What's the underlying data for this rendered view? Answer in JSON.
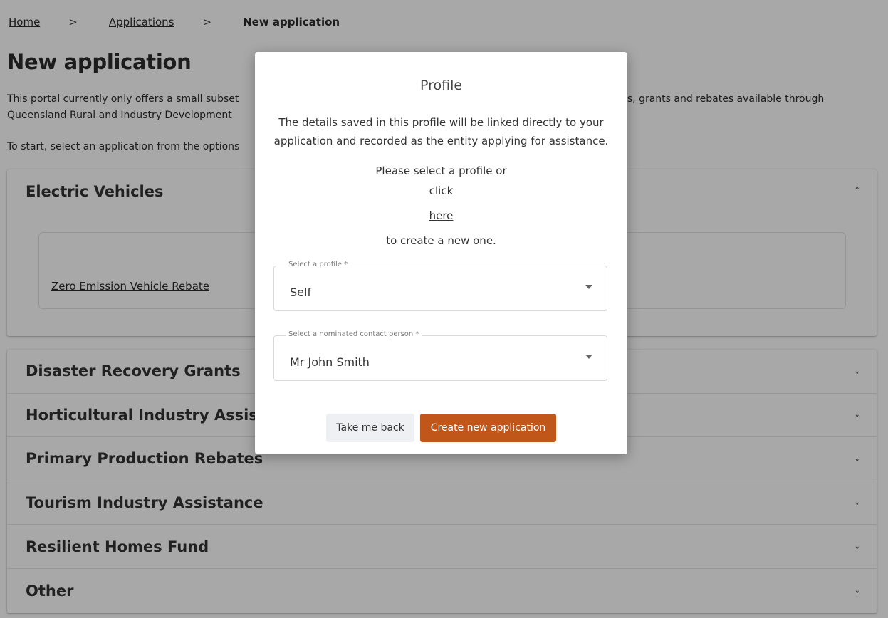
{
  "breadcrumb": {
    "items": [
      {
        "label": "Home"
      },
      {
        "label": "Applications"
      },
      {
        "label": "New application"
      }
    ],
    "separator": ">"
  },
  "page": {
    "title": "New application",
    "intro": "This portal currently only offers a small subset of the loans, grants and rebates available through Queensland Rural and Industry Development Authority. For the full range of loans, grants and rebates available through Queensland Rural and Industry Development Authority, visit our website.",
    "intro_visible_left": "This portal currently only offers a small subset",
    "intro_visible_right": "ns, grants and rebates available through",
    "intro_line2_left": "Queensland Rural and Industry Development",
    "instructions": "To start, select an application from the options"
  },
  "accordion": {
    "sections": [
      {
        "title": "Electric Vehicles",
        "expanded": true,
        "items": [
          {
            "label": "Zero Emission Vehicle Rebate"
          }
        ]
      },
      {
        "title": "Disaster Recovery Grants",
        "expanded": false
      },
      {
        "title": "Horticultural Industry Assistance",
        "expanded": false
      },
      {
        "title": "Primary Production Rebates",
        "expanded": false
      },
      {
        "title": "Tourism Industry Assistance",
        "expanded": false
      },
      {
        "title": "Resilient Homes Fund",
        "expanded": false
      },
      {
        "title": "Other",
        "expanded": false
      }
    ]
  },
  "modal": {
    "title": "Profile",
    "description": "The details saved in this profile will be linked directly to your application and recorded as the entity applying for assistance.",
    "select_prompt": "Please select a profile or",
    "click_text": "click",
    "here_link": "here",
    "create_suffix": "to create a new one.",
    "profile_field": {
      "label": "Select a profile *",
      "value": "Self"
    },
    "contact_field": {
      "label": "Select a nominated contact person *",
      "value": "Mr John Smith"
    },
    "back_button": "Take me back",
    "create_button": "Create new application"
  },
  "colors": {
    "accent": "#c0561a",
    "overlay": "rgba(0,0,0,0.34)",
    "secondary_button": "#eef0f3"
  },
  "icons": {
    "chevron_up": "chevron-up-icon",
    "chevron_down": "chevron-down-icon",
    "dropdown_caret": "caret-down-icon"
  }
}
